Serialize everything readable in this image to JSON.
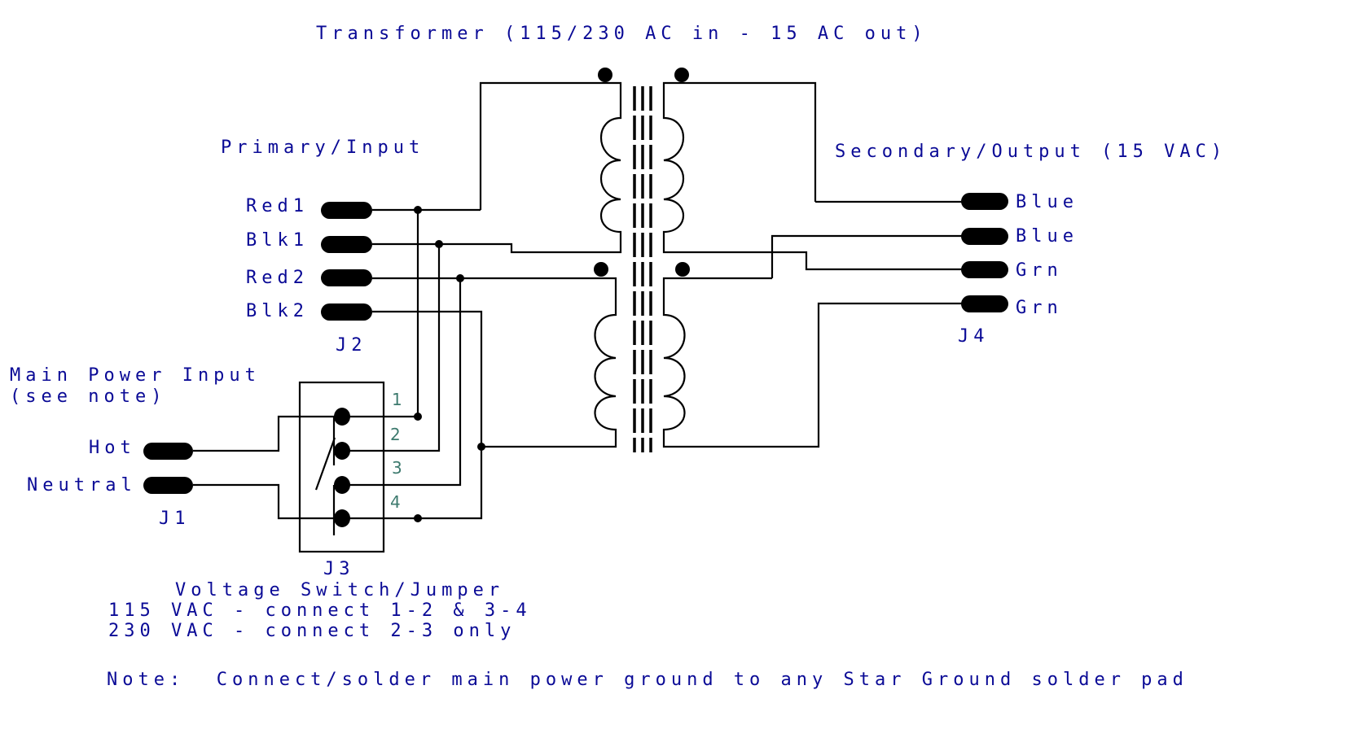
{
  "title": "Transformer (115/230 AC in - 15 AC out)",
  "primary": {
    "heading": "Primary/Input",
    "connector": "J2",
    "pins": [
      "Red1",
      "Blk1",
      "Red2",
      "Blk2"
    ]
  },
  "secondary": {
    "heading": "Secondary/Output (15 VAC)",
    "connector": "J4",
    "pins": [
      "Blue",
      "Blue",
      "Grn",
      "Grn"
    ]
  },
  "main_power": {
    "heading": "Main Power Input",
    "subheading": "(see note)",
    "connector": "J1",
    "pins": [
      "Hot",
      "Neutral"
    ]
  },
  "switch": {
    "connector": "J3",
    "pin_numbers": [
      "1",
      "2",
      "3",
      "4"
    ],
    "caption": "Voltage Switch/Jumper",
    "instructions": [
      "115 VAC - connect 1-2 & 3-4",
      "230 VAC - connect 2-3 only"
    ]
  },
  "note": "Note:  Connect/solder main power ground to any Star Ground solder pad",
  "colors": {
    "label_text": "#0a0a96",
    "pin_number_text": "#3d7a6e",
    "wire": "#000000"
  }
}
